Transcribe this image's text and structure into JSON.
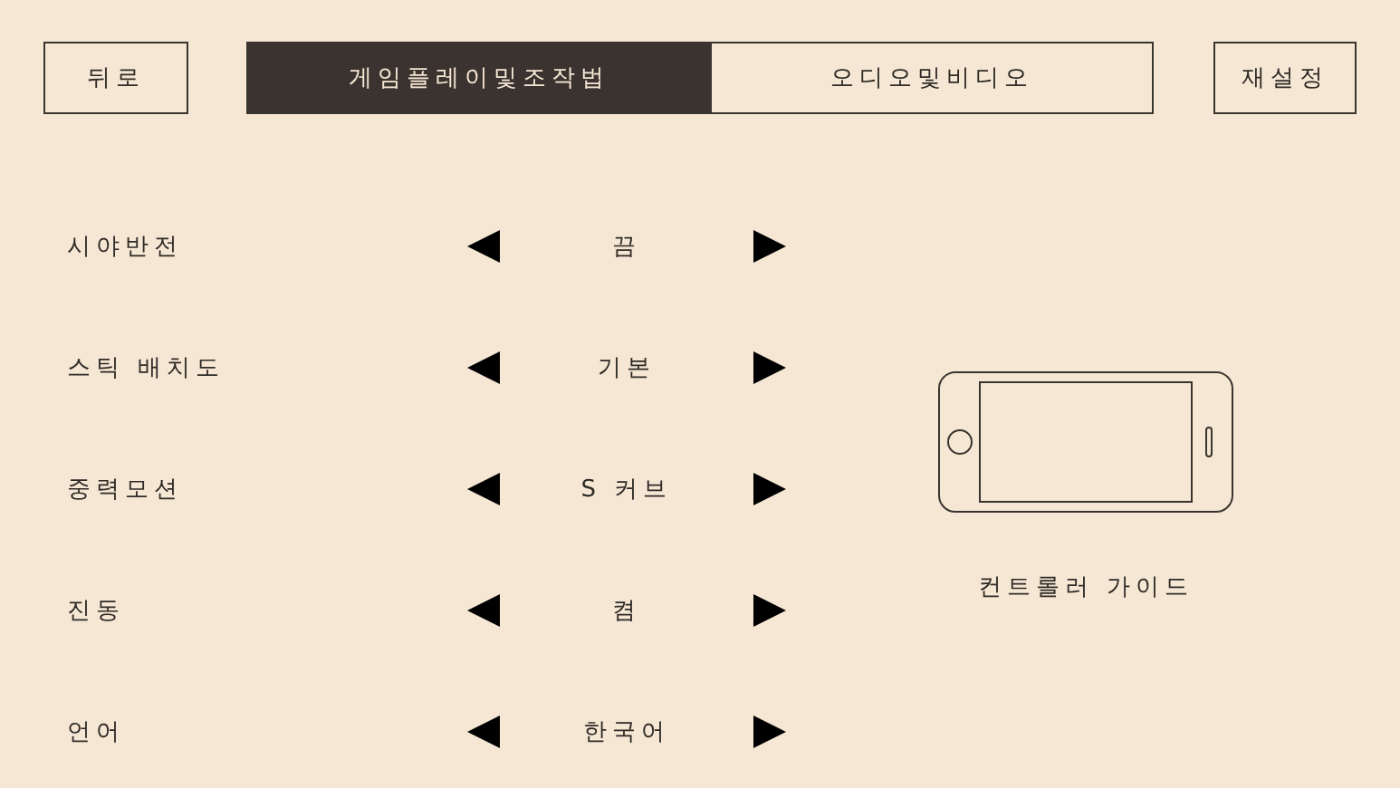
{
  "back_button": "뒤로",
  "tabs": [
    {
      "label": "게임플레이및조작법",
      "selected": true
    },
    {
      "label": "오디오및비디오",
      "selected": false
    }
  ],
  "reset_button": "재설정",
  "settings": [
    {
      "label": "시야반전",
      "value": "끔"
    },
    {
      "label": "스틱 배치도",
      "value": "기본"
    },
    {
      "label": "중력모션",
      "value": "S 커브"
    },
    {
      "label": "진동",
      "value": "켬"
    },
    {
      "label": "언어",
      "value": "한국어"
    }
  ],
  "controller_guide": "컨트롤러 가이드"
}
